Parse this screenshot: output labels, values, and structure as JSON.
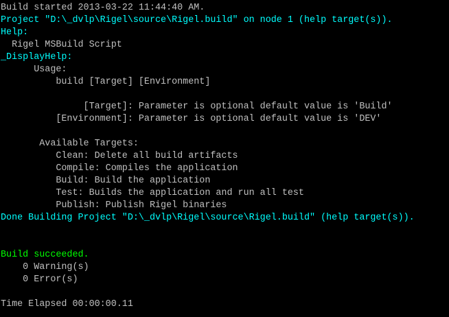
{
  "console": {
    "colors": {
      "background": "#000000",
      "default_text": "#c0c0c0",
      "project_text": "#00ffff",
      "success_text": "#00ff00"
    },
    "lines": {
      "build_started": "Build started 2013-03-22 11:44:40 AM.",
      "project_start": "Project \"D:\\_dvlp\\Rigel\\source\\Rigel.build\" on node 1 (help target(s)).",
      "help_target": "Help:",
      "script_title": "  Rigel MSBuild Script",
      "display_help_target": "_DisplayHelp:",
      "usage_heading": "      Usage:",
      "usage_command": "          build [Target] [Environment]",
      "param_target": "               [Target]: Parameter is optional default value is 'Build'",
      "param_environment": "          [Environment]: Parameter is optional default value is 'DEV'",
      "available_targets_heading": "       Available Targets:",
      "target_clean": "          Clean: Delete all build artifacts",
      "target_compile": "          Compile: Compiles the application",
      "target_build": "          Build: Build the application",
      "target_test": "          Test: Builds the application and run all test",
      "target_publish": "          Publish: Publish Rigel binaries",
      "project_done": "Done Building Project \"D:\\_dvlp\\Rigel\\source\\Rigel.build\" (help target(s)).",
      "build_succeeded": "Build succeeded.",
      "warnings": "    0 Warning(s)",
      "errors": "    0 Error(s)",
      "time_elapsed": "Time Elapsed 00:00:00.11"
    }
  }
}
